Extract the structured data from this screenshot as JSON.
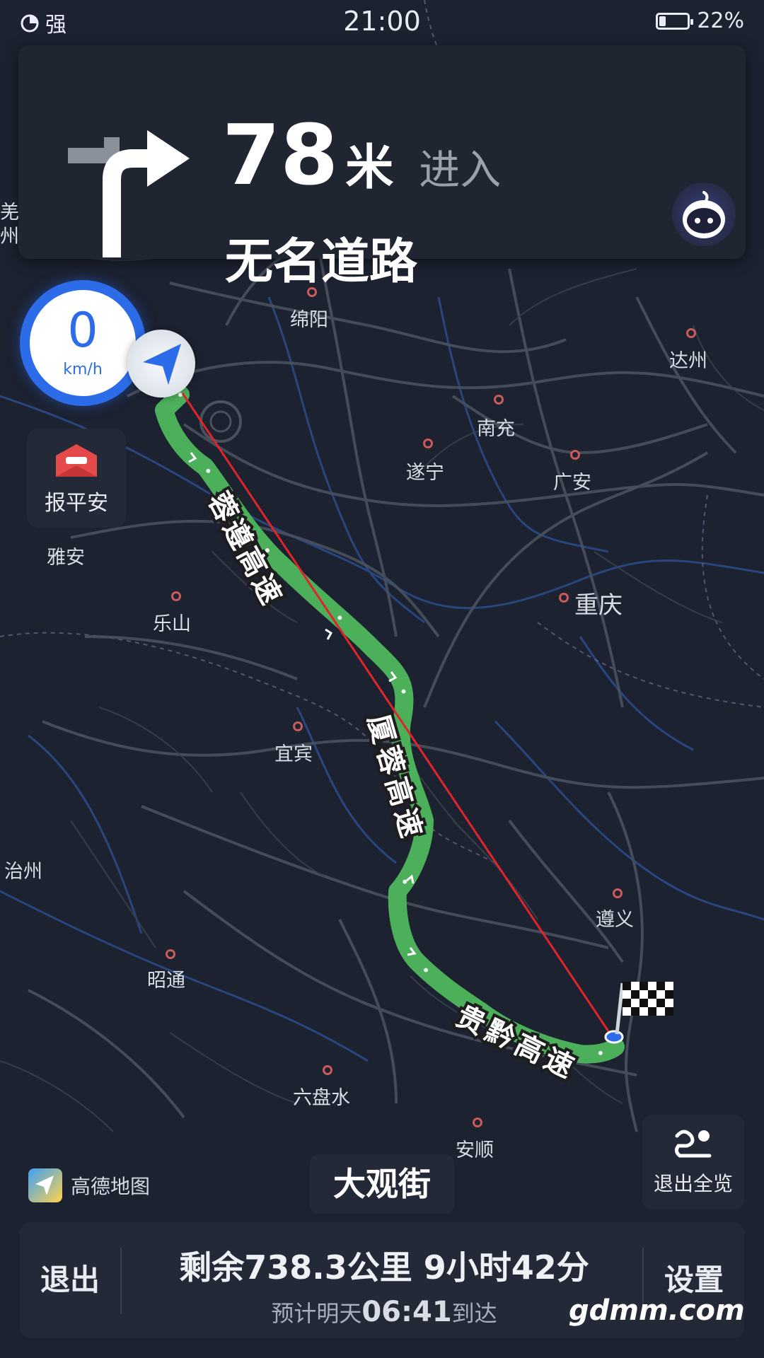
{
  "status_bar": {
    "signal": "强",
    "time": "21:00",
    "battery": "22%"
  },
  "nav": {
    "distance": "78",
    "unit": "米",
    "action": "进入",
    "road": "无名道路"
  },
  "speed": {
    "value": "0",
    "unit": "km/h"
  },
  "safety_button": {
    "label": "报平安"
  },
  "cities": [
    {
      "name": "绵阳"
    },
    {
      "name": "达州"
    },
    {
      "name": "南充"
    },
    {
      "name": "遂宁"
    },
    {
      "name": "广安"
    },
    {
      "name": "重庆"
    },
    {
      "name": "雅安"
    },
    {
      "name": "乐山"
    },
    {
      "name": "宜宾"
    },
    {
      "name": "遵义"
    },
    {
      "name": "昭通"
    },
    {
      "name": "六盘水"
    },
    {
      "name": "安顺"
    },
    {
      "name": "治州"
    },
    {
      "name": "羌"
    },
    {
      "name": "州"
    }
  ],
  "highways": [
    {
      "name": "蓉遵高速"
    },
    {
      "name": "厦蓉高速"
    },
    {
      "name": "贵黔高速"
    }
  ],
  "route_color": "#4caf5a",
  "straight_line_color": "#e0242a",
  "brand": {
    "name": "高德地图"
  },
  "current_street": "大观街",
  "overview_button": {
    "label": "退出全览"
  },
  "bottom": {
    "exit": "退出",
    "remaining": "剩余738.3公里  9小时42分",
    "eta_prefix": "预计明天",
    "eta_time": "06:41",
    "eta_suffix": "到达",
    "settings": "设置"
  },
  "watermark": "gdmm.com"
}
